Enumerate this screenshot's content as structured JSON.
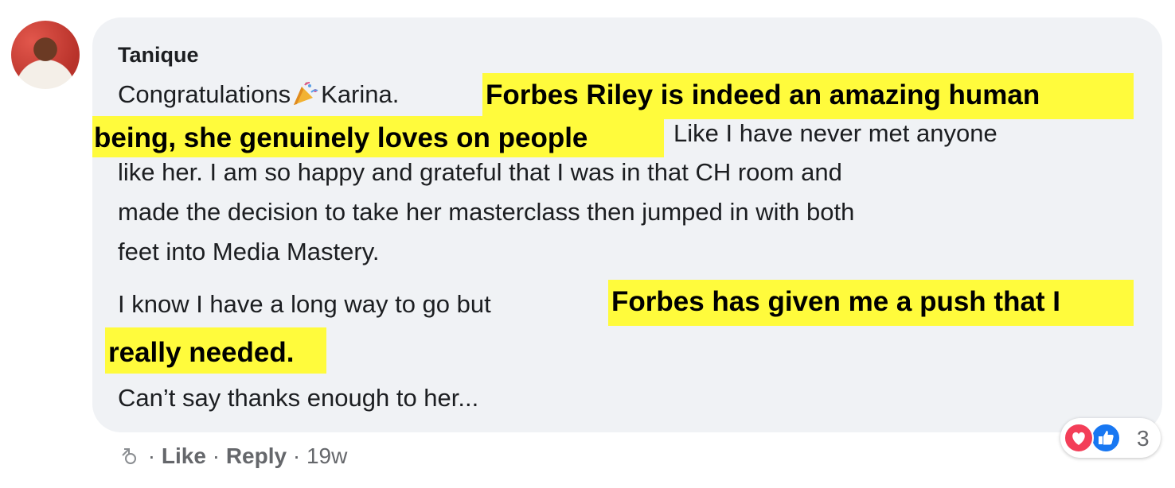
{
  "comment": {
    "author": "Tanique",
    "lines": {
      "l1_pre": "Congratulations",
      "l1_post": "Karina.",
      "l1_highlight": "Forbes Riley is indeed an amazing human",
      "l2_highlight": "being, she genuinely loves on people",
      "l2_post": "Like I have never met anyone",
      "l3": "like her. I am so happy and grateful that I was in that CH room and",
      "l4": "made the decision to take her masterclass then jumped in with both",
      "l5": "feet into Media Mastery.",
      "l6_pre": "I know I have a long way to go but",
      "l6_highlight": "Forbes has given me a push that I",
      "l7_highlight": "really needed.",
      "l8": "Can’t say thanks enough to her..."
    },
    "emoji": "party-popper-icon",
    "highlight_color": "#fffb3c"
  },
  "actions": {
    "separator": "·",
    "like_label": "Like",
    "reply_label": "Reply",
    "timestamp": "19w"
  },
  "reactions": {
    "icons": [
      "heart-reaction-icon",
      "like-reaction-icon"
    ],
    "count": "3"
  }
}
